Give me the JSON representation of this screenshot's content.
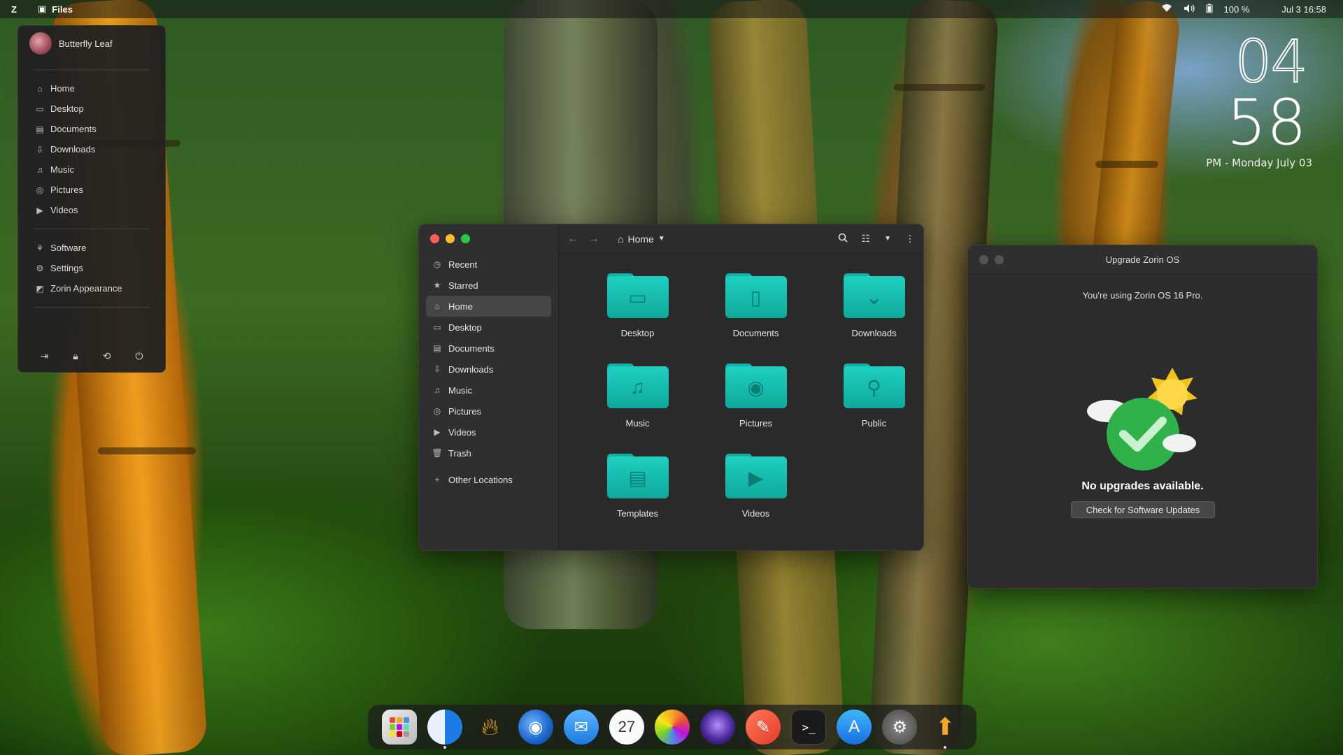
{
  "topbar": {
    "app_name": "Files",
    "battery": "100 %",
    "datetime": "Jul 3  16:58"
  },
  "clock": {
    "hours": "04",
    "minutes": "58",
    "date_line": "PM - Monday July 03"
  },
  "menu": {
    "user_name": "Butterfly Leaf",
    "places": [
      {
        "label": "Home",
        "icon": "home-icon"
      },
      {
        "label": "Desktop",
        "icon": "desktop-icon"
      },
      {
        "label": "Documents",
        "icon": "document-icon"
      },
      {
        "label": "Downloads",
        "icon": "download-icon"
      },
      {
        "label": "Music",
        "icon": "music-icon"
      },
      {
        "label": "Pictures",
        "icon": "camera-icon"
      },
      {
        "label": "Videos",
        "icon": "video-icon"
      }
    ],
    "system": [
      {
        "label": "Software",
        "icon": "software-icon"
      },
      {
        "label": "Settings",
        "icon": "gear-icon"
      },
      {
        "label": "Zorin Appearance",
        "icon": "appearance-icon"
      }
    ],
    "actions": [
      "logout-icon",
      "lock-icon",
      "restart-icon",
      "power-icon"
    ]
  },
  "files": {
    "path": "Home",
    "sidebar": [
      {
        "label": "Recent",
        "icon": "clock-icon"
      },
      {
        "label": "Starred",
        "icon": "star-icon"
      },
      {
        "label": "Home",
        "icon": "home-icon",
        "active": true
      },
      {
        "label": "Desktop",
        "icon": "desktop-icon"
      },
      {
        "label": "Documents",
        "icon": "document-icon"
      },
      {
        "label": "Downloads",
        "icon": "download-icon"
      },
      {
        "label": "Music",
        "icon": "music-icon"
      },
      {
        "label": "Pictures",
        "icon": "camera-icon"
      },
      {
        "label": "Videos",
        "icon": "video-icon"
      },
      {
        "label": "Trash",
        "icon": "trash-icon"
      }
    ],
    "other_locations": "Other Locations",
    "folders": [
      {
        "label": "Desktop",
        "glyph": "▭"
      },
      {
        "label": "Documents",
        "glyph": "▯"
      },
      {
        "label": "Downloads",
        "glyph": "⌄"
      },
      {
        "label": "Music",
        "glyph": "♫"
      },
      {
        "label": "Pictures",
        "glyph": "◉"
      },
      {
        "label": "Public",
        "glyph": "⚲"
      },
      {
        "label": "Templates",
        "glyph": "▤"
      },
      {
        "label": "Videos",
        "glyph": "▶"
      }
    ]
  },
  "upgrade": {
    "title": "Upgrade Zorin OS",
    "message": "You're using Zorin OS 16 Pro.",
    "status": "No upgrades available.",
    "button": "Check for Software Updates"
  },
  "dock": {
    "calendar_day": "27",
    "apps": [
      "launcher",
      "finder",
      "flame",
      "firefox",
      "mail",
      "calendar",
      "photos",
      "siri",
      "pencil",
      "terminal",
      "app-store",
      "system-preferences",
      "software-updater"
    ]
  },
  "colors": {
    "folder_accent": "#1ed0c0",
    "close": "#ff5f57",
    "minimize": "#febc2e",
    "maximize": "#28c840"
  }
}
